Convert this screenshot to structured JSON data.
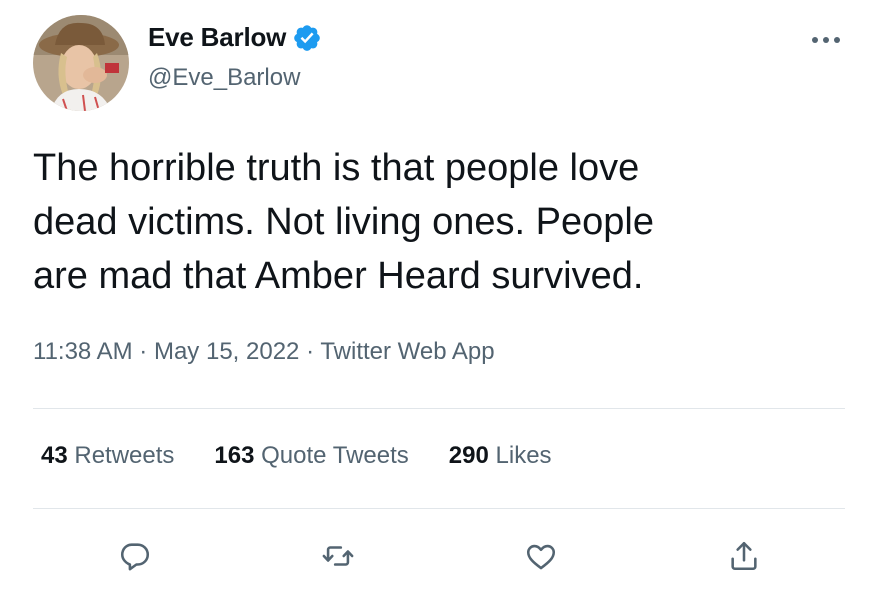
{
  "tweet": {
    "author": {
      "display_name": "Eve Barlow",
      "handle": "@Eve_Barlow",
      "verified": true
    },
    "text_lines": [
      "The horrible truth is that people love",
      "dead victims. Not living ones. People",
      "are mad that Amber Heard survived."
    ],
    "time": "11:38 AM",
    "date": "May 15, 2022",
    "source": "Twitter Web App",
    "separator": "·",
    "stats": {
      "retweets_count": "43",
      "retweets_label": "Retweets",
      "quotes_count": "163",
      "quotes_label": "Quote Tweets",
      "likes_count": "290",
      "likes_label": "Likes"
    },
    "actions": [
      "reply-icon",
      "retweet-icon",
      "like-icon",
      "share-icon"
    ]
  },
  "colors": {
    "text_primary": "#0f1419",
    "text_secondary": "#536471",
    "verified_blue": "#1d9bf0",
    "divider": "#e1e6ea"
  }
}
